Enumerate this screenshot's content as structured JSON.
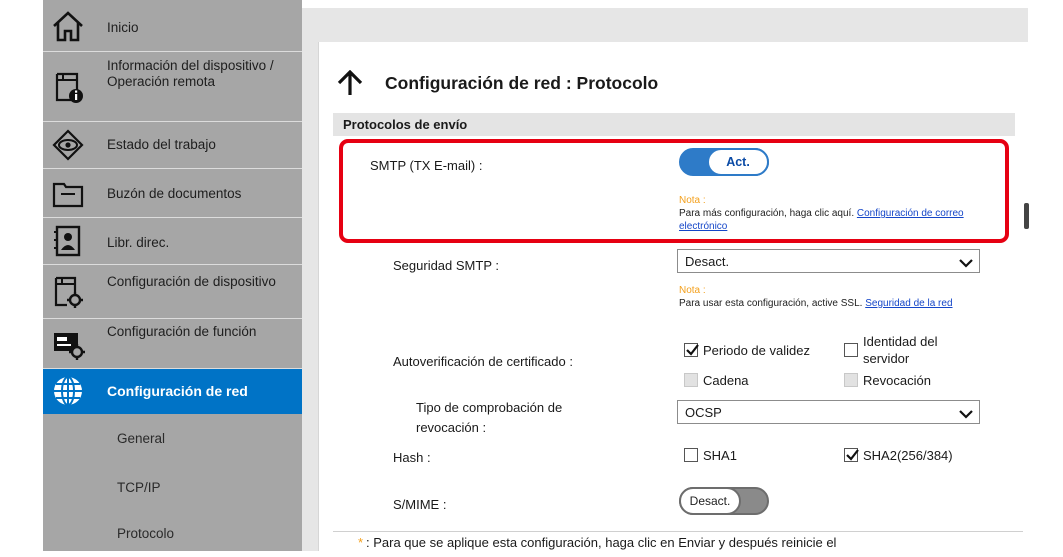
{
  "sidebar": {
    "items": [
      {
        "label": "Inicio",
        "icon": "home-icon"
      },
      {
        "label": "Información del dispositivo / Operación remota",
        "icon": "device-info-icon"
      },
      {
        "label": "Estado del trabajo",
        "icon": "job-status-icon"
      },
      {
        "label": "Buzón de documentos",
        "icon": "document-box-icon"
      },
      {
        "label": "Libr. direc.",
        "icon": "address-book-icon"
      },
      {
        "label": "Configuración de dispositivo",
        "icon": "device-settings-icon"
      },
      {
        "label": "Configuración de función",
        "icon": "function-settings-icon"
      },
      {
        "label": "Configuración de red",
        "icon": "globe-icon"
      }
    ],
    "subitems": [
      "General",
      "TCP/IP",
      "Protocolo"
    ],
    "colors": {
      "background": "#a6a6a6",
      "active": "#0073c6"
    }
  },
  "page": {
    "title": "Configuración de red : Protocolo",
    "section_title": "Protocolos de envío"
  },
  "smtp": {
    "label": "SMTP (TX E-mail) :",
    "toggle_label": "Act.",
    "toggle_state": "on",
    "note_label": "Nota :",
    "note_text": "Para más configuración, haga clic aquí.",
    "note_link": "Configuración de correo electrónico"
  },
  "smtp_security": {
    "label": "Seguridad SMTP :",
    "value": "Desact.",
    "note_label": "Nota :",
    "note_text": "Para usar esta configuración, active SSL.",
    "note_link": "Seguridad de la red"
  },
  "cert_check": {
    "label": "Autoverificación de certificado :",
    "options": [
      {
        "label": "Periodo de validez",
        "checked": true,
        "enabled": true
      },
      {
        "label": "Identidad del servidor",
        "checked": false,
        "enabled": true
      },
      {
        "label": "Cadena",
        "checked": false,
        "enabled": false
      },
      {
        "label": "Revocación",
        "checked": false,
        "enabled": false
      }
    ]
  },
  "revocation_type": {
    "label": "Tipo de comprobación de revocación :",
    "value": "OCSP"
  },
  "hash": {
    "label": "Hash :",
    "options": [
      {
        "label": "SHA1",
        "checked": false
      },
      {
        "label": "SHA2(256/384)",
        "checked": true
      }
    ]
  },
  "smime": {
    "label": "S/MIME :",
    "toggle_label": "Desact.",
    "toggle_state": "off"
  },
  "footer": {
    "asterisk": "*",
    "text": ":  Para que se aplique esta configuración, haga clic en Enviar y después reinicie el"
  },
  "highlight_color": "#e60012"
}
